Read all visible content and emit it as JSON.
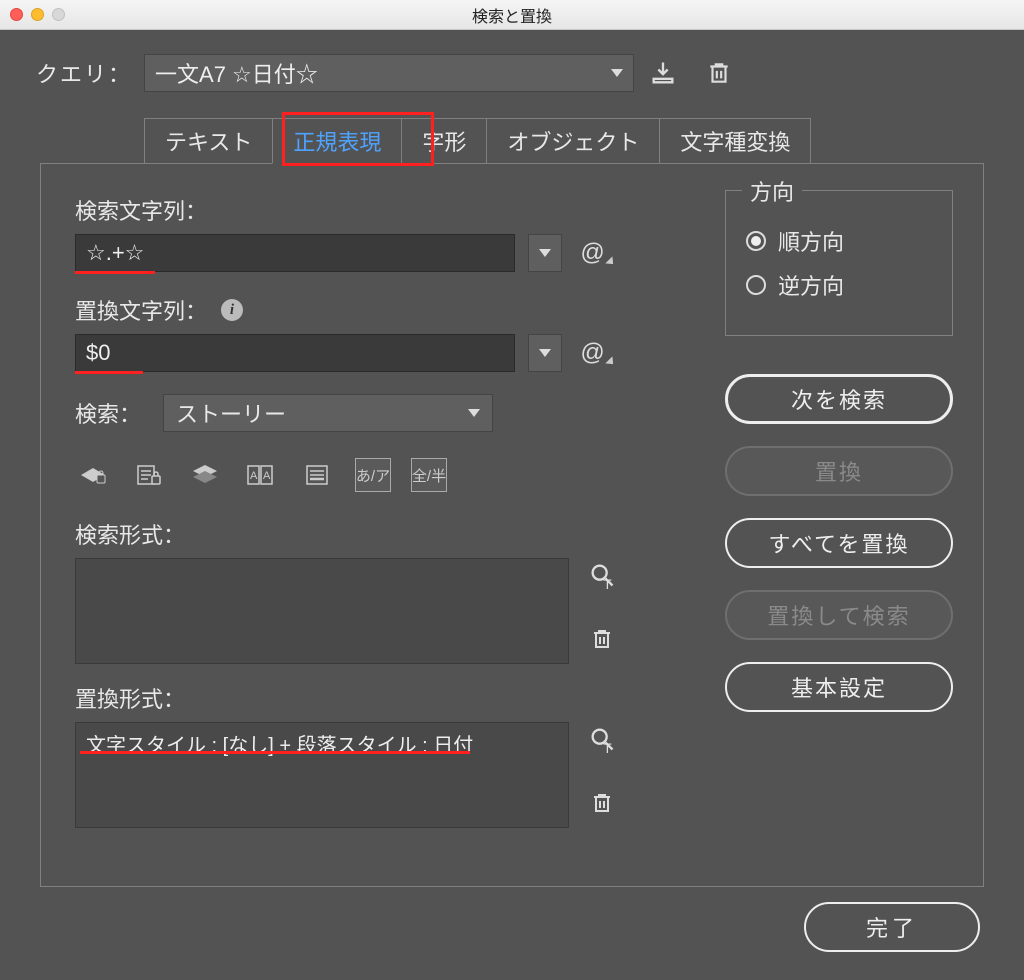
{
  "window": {
    "title": "検索と置換"
  },
  "query": {
    "label": "クエリ：",
    "value": "一文A7 ☆日付☆"
  },
  "tabs": [
    {
      "label": "テキスト",
      "active": false
    },
    {
      "label": "正規表現",
      "active": true
    },
    {
      "label": "字形",
      "active": false
    },
    {
      "label": "オブジェクト",
      "active": false
    },
    {
      "label": "文字種変換",
      "active": false
    }
  ],
  "find": {
    "label": "検索文字列：",
    "value": "☆.+☆"
  },
  "replace": {
    "label": "置換文字列：",
    "value": "$0"
  },
  "scope": {
    "label": "検索：",
    "value": "ストーリー"
  },
  "toolbar": {
    "kana_label": "あ/ア",
    "width_label": "全/半"
  },
  "find_format": {
    "label": "検索形式：",
    "value": ""
  },
  "replace_format": {
    "label": "置換形式：",
    "value": "文字スタイル : [なし] + 段落スタイル : 日付"
  },
  "direction": {
    "legend": "方向",
    "forward": "順方向",
    "backward": "逆方向",
    "selected": "forward"
  },
  "buttons": {
    "find_next": "次を検索",
    "replace": "置換",
    "replace_all": "すべてを置換",
    "replace_find": "置換して検索",
    "basic_settings": "基本設定",
    "done": "完了"
  }
}
